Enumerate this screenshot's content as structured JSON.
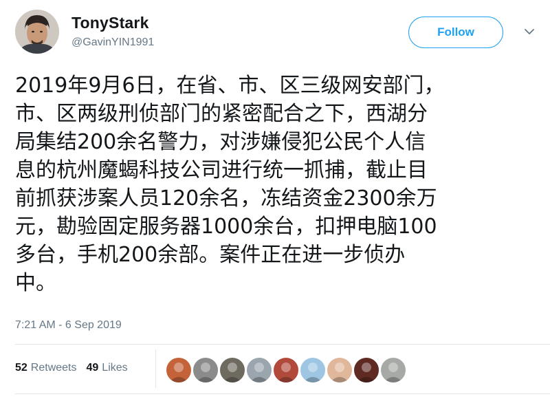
{
  "user": {
    "display_name": "TonyStark",
    "handle": "@GavinYIN1991"
  },
  "follow_button": {
    "label": "Follow"
  },
  "tweet": {
    "lines": [
      "2019年9月6日，在省、市、区三级网安部门，",
      "市、区两级刑侦部门的紧密配合之下，西湖分",
      "局集结200余名警力，对涉嫌侵犯公民个人信",
      "息的杭州魔蝎科技公司进行统一抓捕，截止目",
      "前抓获涉案人员120余名，冻结资金2300余万",
      "元，勘验固定服务器1000余台，扣押电脑100",
      "多台，手机200余部。案件正在进一步侦办",
      "中。"
    ],
    "timestamp": "7:21 AM - 6 Sep 2019"
  },
  "stats": {
    "retweets_count": "52",
    "retweets_label": "Retweets",
    "likes_count": "49",
    "likes_label": "Likes"
  },
  "colors": {
    "accent": "#1da1f2",
    "text": "#14171a",
    "muted": "#657786",
    "divider": "#e1e8ed"
  },
  "liker_avatars": [
    {
      "icon": "sunset-avatar-icon",
      "color": "#c4623a"
    },
    {
      "icon": "person-avatar-icon",
      "color": "#8b8b8b"
    },
    {
      "icon": "figure-avatar-icon",
      "color": "#6e6a60"
    },
    {
      "icon": "figure-avatar-icon",
      "color": "#9aa5ad"
    },
    {
      "icon": "cartoon-avatar-icon",
      "color": "#b24a3c"
    },
    {
      "icon": "bird-avatar-icon",
      "color": "#9ec6e3"
    },
    {
      "icon": "person-avatar-icon",
      "color": "#e0b79a"
    },
    {
      "icon": "person-avatar-icon",
      "color": "#5e2a22"
    },
    {
      "icon": "figure-avatar-icon",
      "color": "#a7a9a6"
    }
  ]
}
